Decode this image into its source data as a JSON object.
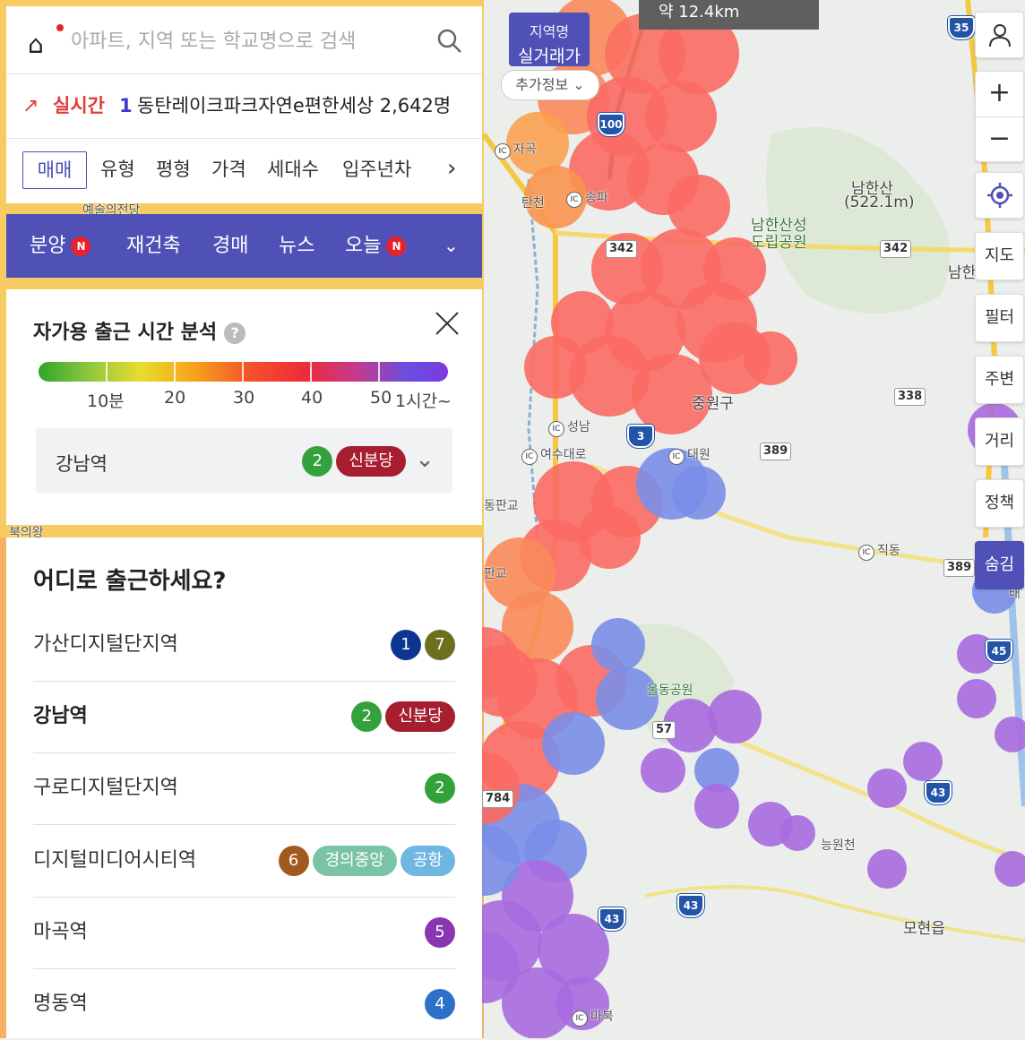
{
  "search": {
    "placeholder": "아파트, 지역 또는 학교명으로 검색",
    "logo_icon": "home-logo-icon",
    "search_icon": "search-icon"
  },
  "realtime": {
    "label": "실시간",
    "rank": "1",
    "text": "동탄레이크파크자연e편한세상 2,642명"
  },
  "filters": {
    "active": "매매",
    "items": [
      "유형",
      "평형",
      "가격",
      "세대수",
      "입주년차"
    ],
    "more_icon": "chevron-right-icon"
  },
  "tabs": {
    "items": [
      {
        "label": "분양",
        "badge": "N"
      },
      {
        "label": "재건축",
        "badge": ""
      },
      {
        "label": "경매",
        "badge": ""
      },
      {
        "label": "뉴스",
        "badge": ""
      },
      {
        "label": "오늘",
        "badge": "N"
      }
    ]
  },
  "analysis": {
    "title": "자가용 출근 시간 분석",
    "help": "?",
    "scale_labels": [
      "10분",
      "20",
      "30",
      "40",
      "50",
      "1시간~"
    ],
    "selected_station": "강남역",
    "selected_lines": [
      {
        "text": "2",
        "color": "#33a23d",
        "shape": "circle"
      },
      {
        "text": "신분당",
        "color": "#a71e31",
        "shape": "pill"
      }
    ]
  },
  "destinations": {
    "title": "어디로 출근하세요?",
    "items": [
      {
        "name": "가산디지털단지역",
        "bold": false,
        "lines": [
          {
            "text": "1",
            "color": "#0d3692",
            "shape": "circle"
          },
          {
            "text": "7",
            "color": "#6b6f1e",
            "shape": "circle"
          }
        ]
      },
      {
        "name": "강남역",
        "bold": true,
        "lines": [
          {
            "text": "2",
            "color": "#33a23d",
            "shape": "circle"
          },
          {
            "text": "신분당",
            "color": "#a71e31",
            "shape": "pill"
          }
        ]
      },
      {
        "name": "구로디지털단지역",
        "bold": false,
        "lines": [
          {
            "text": "2",
            "color": "#33a23d",
            "shape": "circle"
          }
        ]
      },
      {
        "name": "디지털미디어시티역",
        "bold": false,
        "lines": [
          {
            "text": "6",
            "color": "#a05a1e",
            "shape": "circle"
          },
          {
            "text": "경의중앙",
            "color": "#7ac4a5",
            "shape": "pill"
          },
          {
            "text": "공항",
            "color": "#6fb7e3",
            "shape": "pill"
          }
        ]
      },
      {
        "name": "마곡역",
        "bold": false,
        "lines": [
          {
            "text": "5",
            "color": "#8936b1",
            "shape": "circle"
          }
        ]
      },
      {
        "name": "명동역",
        "bold": false,
        "lines": [
          {
            "text": "4",
            "color": "#2d70c8",
            "shape": "circle"
          }
        ]
      }
    ]
  },
  "map": {
    "info_line1": "지역명",
    "info_line2": "실거래가",
    "add_info": "추가정보",
    "distance": "약 12.4km",
    "labels": [
      "남한산",
      "(522.1m)",
      "남한산성",
      "도립공원",
      "중원구",
      "울동공원",
      "모현읍",
      "능원천",
      "직동",
      "자곡",
      "송파",
      "성남",
      "여수대로",
      "대원",
      "동판교",
      "판교",
      "북의왕",
      "예술의전당",
      "마북",
      "태",
      "남한",
      "탄천"
    ],
    "road_numbers": [
      "342",
      "342",
      "338",
      "389",
      "389",
      "57",
      "784"
    ],
    "highway_numbers": [
      "35",
      "100",
      "3",
      "43",
      "43",
      "43",
      "45"
    ]
  },
  "controls": {
    "profile_icon": "person-icon",
    "zoom_in": "+",
    "zoom_out": "−",
    "locate_icon": "locate-icon",
    "buttons": [
      "지도",
      "필터",
      "주변",
      "거리",
      "정책",
      "숨김"
    ]
  },
  "colors": {
    "brand": "#4f51b6",
    "accent_red": "#e8212a"
  }
}
